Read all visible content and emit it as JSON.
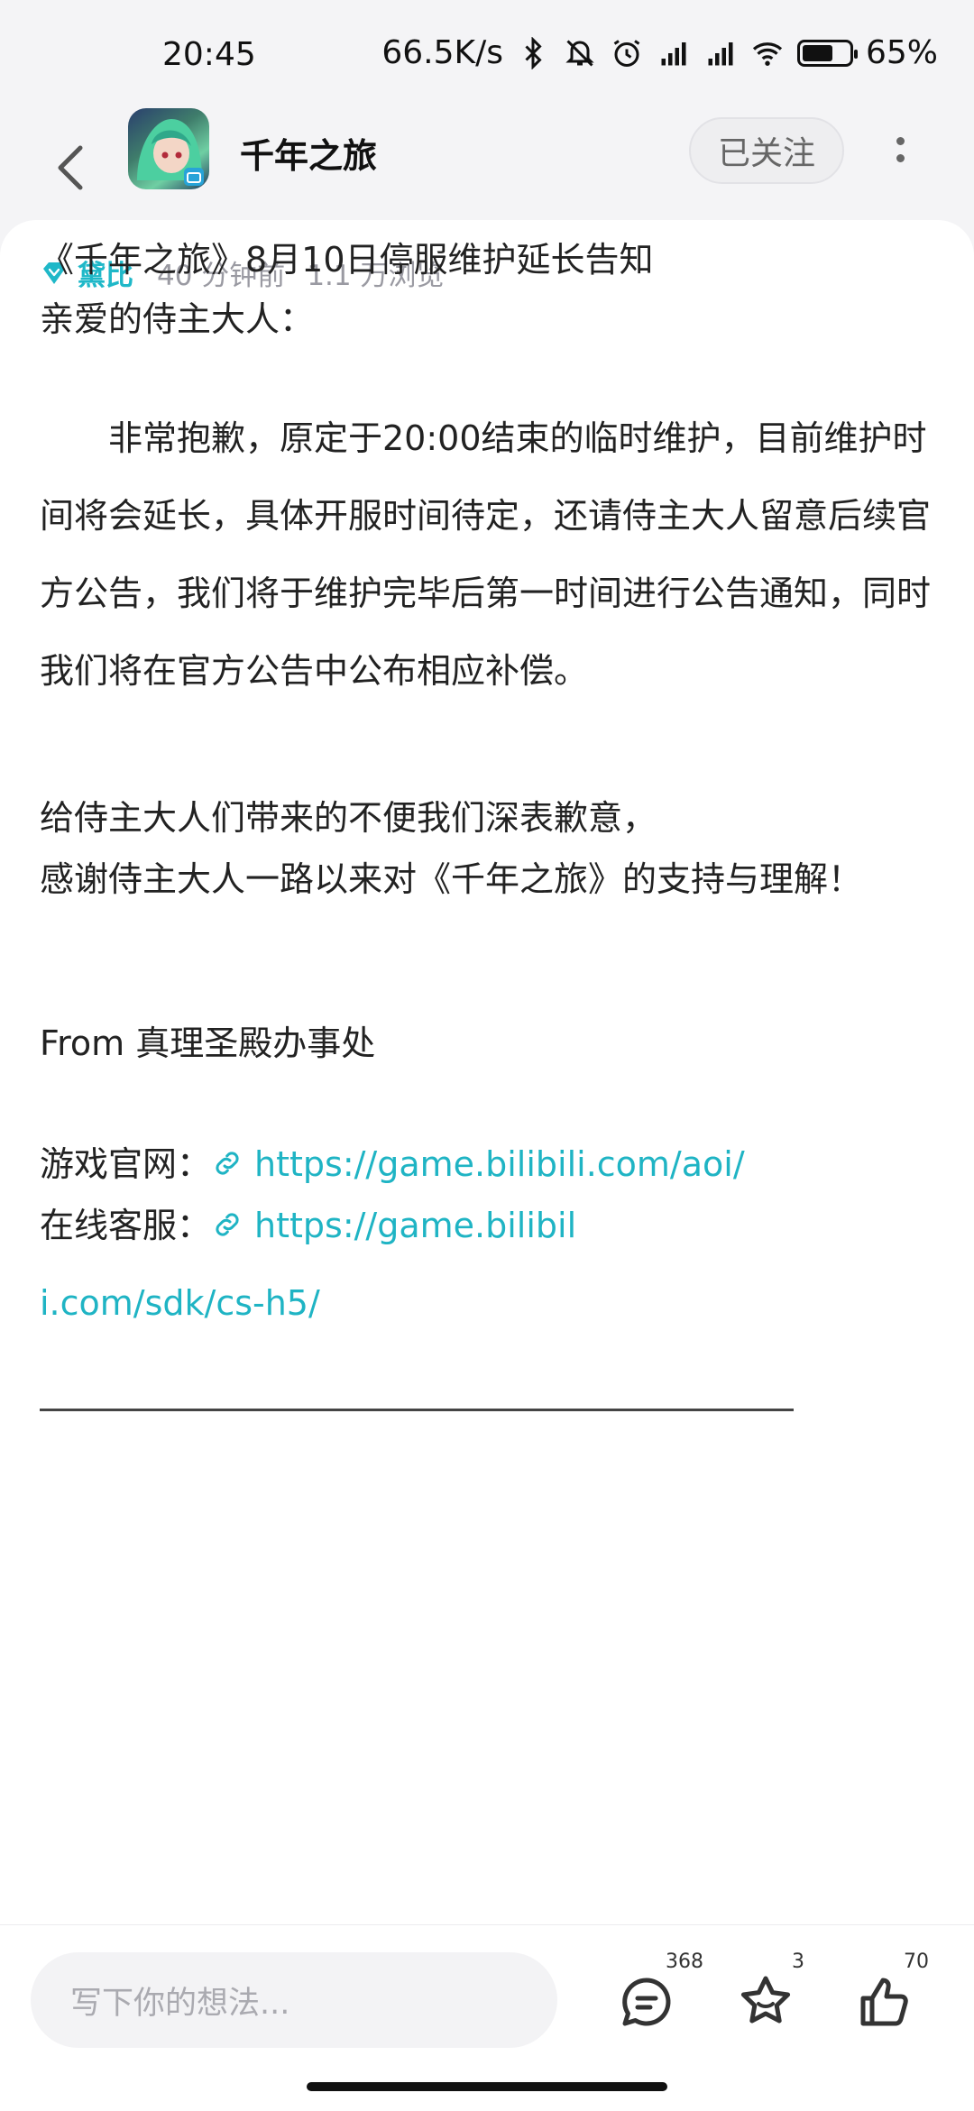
{
  "status": {
    "time": "20:45",
    "net_speed": "66.5K/s",
    "battery_text": "65%",
    "battery_level": 0.65,
    "icons": [
      "bluetooth-icon",
      "mute-icon",
      "alarm-icon",
      "signal-hd-icon",
      "signal-hd-icon",
      "wifi-icon",
      "battery-icon"
    ]
  },
  "header": {
    "title": "千年之旅",
    "follow_label": "已关注"
  },
  "post": {
    "author": "黛比",
    "time_ago": "40 分钟前",
    "views": "1.1 万浏览",
    "title_line": "《千年之旅》8月10日停服维护延长告知",
    "greeting": "亲爱的侍主大人：",
    "para1": "　　非常抱歉，原定于20:00结束的临时维护，目前维护时间将会延长，具体开服时间待定，还请侍主大人留意后续官方公告，我们将于维护完毕后第一时间进行公告通知，同时我们将在官方公告中公布相应补偿。",
    "apology": "给侍主大人们带来的不便我们深表歉意，",
    "thanks": "感谢侍主大人一路以来对《千年之旅》的支持与理解！",
    "from": "From 真理圣殿办事处",
    "site_label": "游戏官网：",
    "site_url": "https://game.bilibili.com/aoi/",
    "service_label": "在线客服：",
    "service_url": "https://game.bilibili.com/sdk/cs-h5/"
  },
  "bottom": {
    "placeholder": "写下你的想法...",
    "comment_count": "368",
    "favorite_count": "3",
    "like_count": "70"
  },
  "colors": {
    "accent": "#1fb4c4"
  }
}
